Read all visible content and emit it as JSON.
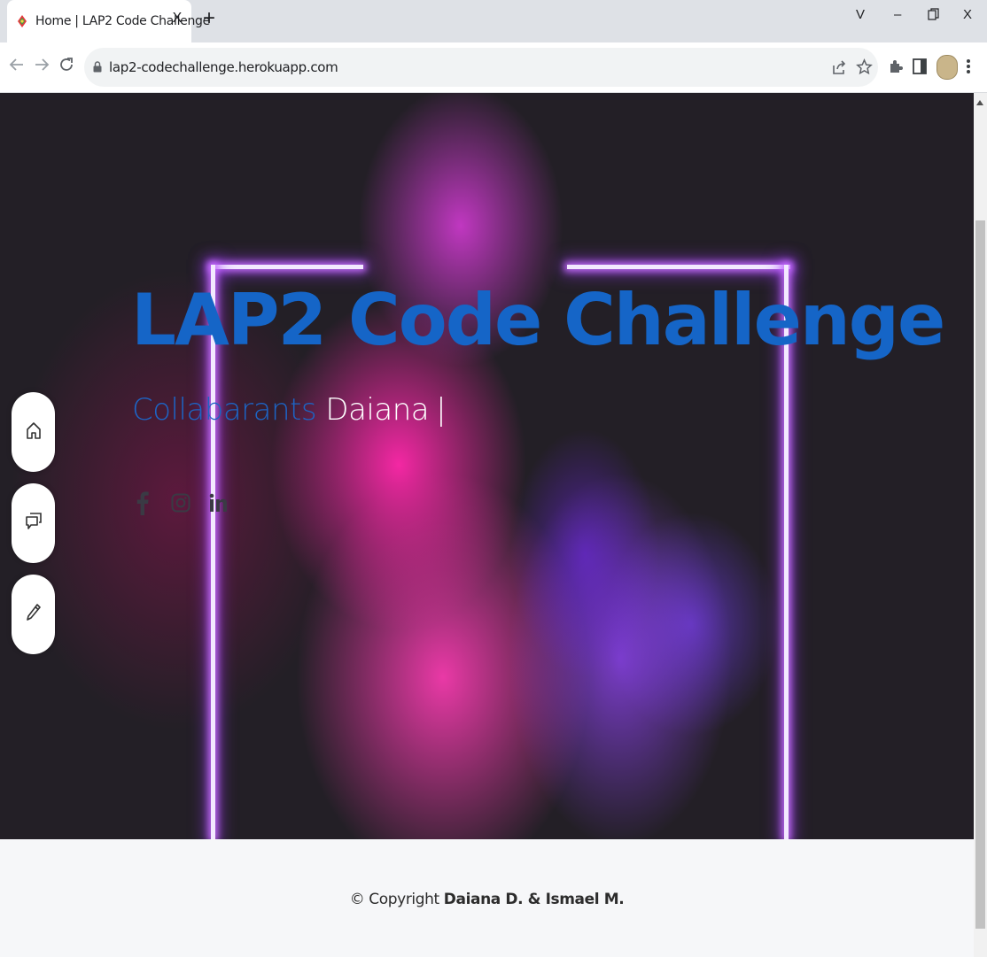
{
  "browser": {
    "tab_title": "Home | LAP2 Code Challenge",
    "tab_close": "X",
    "new_tab": "+",
    "url": "lap2-codechallenge.herokuapp.com",
    "window_controls": {
      "dropdown": "V",
      "minimize": "–",
      "close": "X"
    },
    "nav": {
      "back": "←",
      "forward": "→",
      "reload": "C"
    }
  },
  "hero": {
    "title": "LAP2 Code Challenge",
    "subtitle_lead": "Collabarants",
    "subtitle_typed": "Daiana",
    "caret": "|",
    "social_icons": [
      "facebook-icon",
      "instagram-icon",
      "linkedin-icon"
    ]
  },
  "side_nav": {
    "buttons": [
      {
        "name": "home",
        "icon": "home-icon"
      },
      {
        "name": "comments",
        "icon": "chat-icon"
      },
      {
        "name": "edit",
        "icon": "pencil-icon"
      }
    ]
  },
  "footer": {
    "prefix": "© Copyright",
    "authors": "Daiana D. & Ismael M."
  },
  "colors": {
    "title_blue": "#1565c7",
    "hero_bg": "#231f26",
    "footer_bg": "#f6f7f9"
  }
}
